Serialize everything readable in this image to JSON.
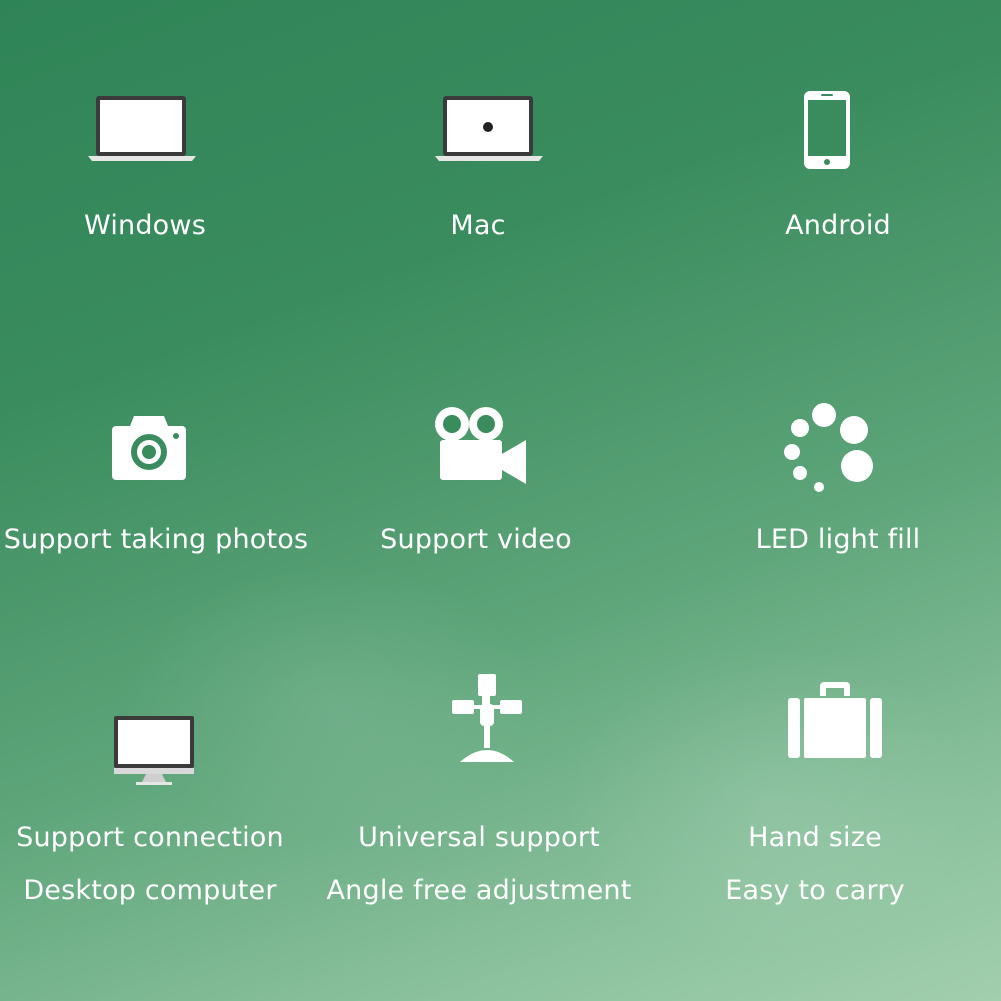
{
  "features": [
    {
      "label": "Windows",
      "icon": "laptop-icon"
    },
    {
      "label": "Mac",
      "icon": "macbook-icon"
    },
    {
      "label": "Android",
      "icon": "smartphone-icon"
    },
    {
      "label": "Support taking photos",
      "icon": "camera-icon"
    },
    {
      "label": "Support video",
      "icon": "video-camera-icon"
    },
    {
      "label": "LED light fill",
      "icon": "led-dots-icon"
    },
    {
      "label": "Support connection",
      "label2": "Desktop computer",
      "icon": "desktop-monitor-icon"
    },
    {
      "label": "Universal support",
      "label2": "Angle free adjustment",
      "icon": "adjustable-stand-icon"
    },
    {
      "label": "Hand size",
      "label2": "Easy to carry",
      "icon": "briefcase-icon"
    }
  ],
  "colors": {
    "text": "#ffffff",
    "bg_top": "#2f8457",
    "bg_bottom": "#a2cfae"
  }
}
